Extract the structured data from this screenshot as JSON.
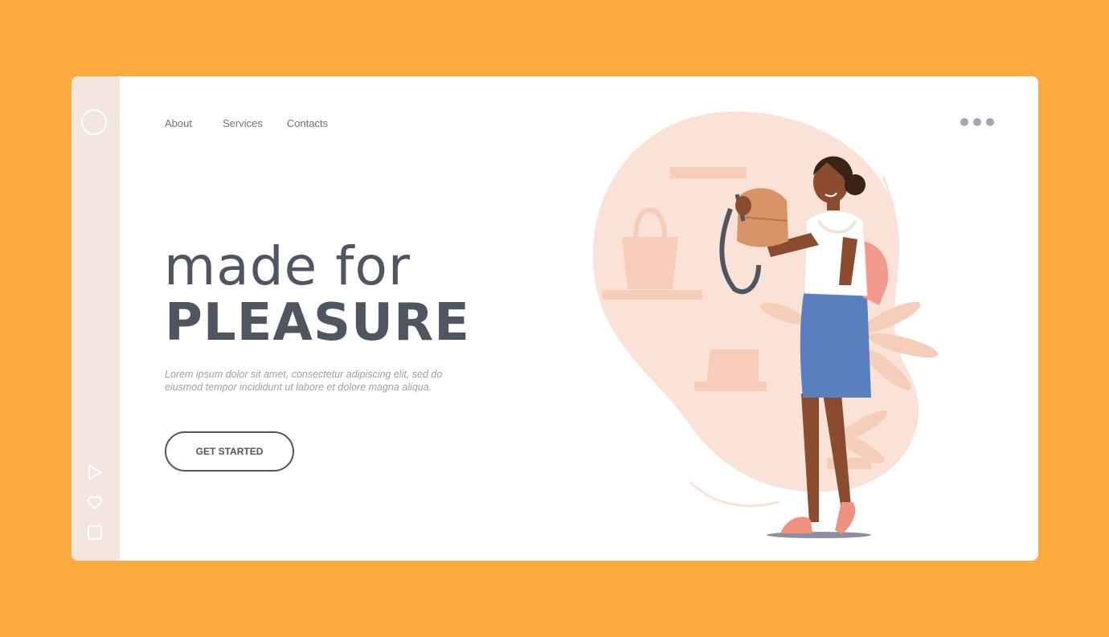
{
  "nav": {
    "items": [
      {
        "label": "About"
      },
      {
        "label": "Services"
      },
      {
        "label": "Contacts"
      }
    ]
  },
  "hero": {
    "headline_line1": "made for",
    "headline_line2": "PLEASURE",
    "body": "Lorem ipsum dolor sit amet, consectetur adipiscing elit, sed do eiusmod tempor incididunt ut labore et dolore magna aliqua.",
    "cta_label": "GET STARTED"
  },
  "rail": {
    "icons": [
      "play-icon",
      "heart-icon",
      "square-icon"
    ]
  },
  "colors": {
    "background": "#FDAA3F",
    "rail": "#F3E6DE",
    "text_dark": "#4F5561",
    "blob": "#FBE2D6"
  }
}
